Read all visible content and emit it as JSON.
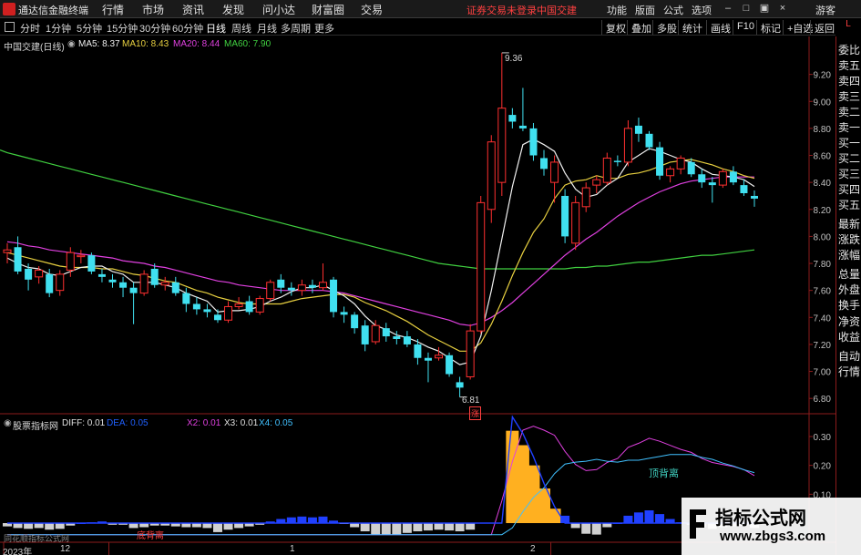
{
  "app": {
    "title": "通达信金融终端",
    "menu": [
      "行情",
      "市场",
      "资讯",
      "发现",
      "问小达",
      "财富圈",
      "交易"
    ],
    "login_status": "证券交易未登录",
    "stock_name": "中国交建",
    "right_menu": [
      "功能",
      "版面",
      "公式",
      "选项"
    ],
    "guest_label": "游客"
  },
  "toolbar": {
    "periods": [
      "分时",
      "1分钟",
      "5分钟",
      "15分钟",
      "30分钟",
      "60分钟",
      "日线",
      "周线",
      "月线",
      "多周期",
      "更多"
    ],
    "active_period": "日线",
    "right_buttons": [
      "复权",
      "叠加",
      "多股",
      "统计",
      "画线",
      "F10",
      "标记",
      "+自选",
      "返回"
    ]
  },
  "side_panel": {
    "top_label": "L",
    "items": [
      "委比",
      "卖五",
      "卖四",
      "卖三",
      "卖二",
      "卖一",
      "买一",
      "买二",
      "买三",
      "买四",
      "买五",
      "最新",
      "涨跌",
      "涨幅",
      "总量",
      "外盘",
      "换手",
      "净资",
      "收益",
      "自动",
      "行情"
    ]
  },
  "main_chart": {
    "title": "中国交建(日线)",
    "ma_legend": [
      {
        "label": "MA5: 8.37",
        "color": "#f0f0f0"
      },
      {
        "label": "MA10: 8.43",
        "color": "#e8d040"
      },
      {
        "label": "MA20: 8.44",
        "color": "#e040e0"
      },
      {
        "label": "MA60: 7.90",
        "color": "#40d040"
      }
    ],
    "price_ticks": [
      "9.20",
      "9.00",
      "8.80",
      "8.60",
      "8.40",
      "8.20",
      "8.00",
      "7.80",
      "7.60",
      "7.40",
      "7.20",
      "7.00",
      "6.80"
    ],
    "high_label": "9.36",
    "low_label": "6.81",
    "rise_marker": "涨"
  },
  "indicator": {
    "title": "股票指标网",
    "legend": [
      {
        "label": "DIFF: 0.01",
        "color": "#e0e0e0"
      },
      {
        "label": "DEA: 0.05",
        "color": "#2060ff"
      },
      {
        "label": "X2: 0.01",
        "color": "#e040e0"
      },
      {
        "label": "X3: 0.01",
        "color": "#e0e0e0"
      },
      {
        "label": "X4: 0.05",
        "color": "#40c0ff"
      }
    ],
    "ticks": [
      "0.30",
      "0.20",
      "0.10"
    ],
    "annotation_top": "顶背离",
    "annotation_bottom": "底背离"
  },
  "bottom_axis": {
    "labels": [
      "2023年",
      "12",
      "1",
      "2"
    ],
    "left_caption": "同花顺指标公式网"
  },
  "watermark": {
    "title": "指标公式网",
    "url": "www.zbgs3.com"
  },
  "colors": {
    "up": "#ff3030",
    "down": "#40e0f0",
    "ma5": "#f0f0f0",
    "ma10": "#e8d040",
    "ma20": "#e040e0",
    "ma60": "#40d040",
    "macd_hist": "#ffb020",
    "macd_blue": "#2040ff"
  },
  "chart_data": {
    "type": "candlestick",
    "title": "中国交建(日线)",
    "y_range": [
      6.7,
      9.4
    ],
    "candles": [
      {
        "o": 7.88,
        "h": 7.95,
        "l": 7.8,
        "c": 7.9
      },
      {
        "o": 7.92,
        "h": 8.0,
        "l": 7.72,
        "c": 7.74
      },
      {
        "o": 7.76,
        "h": 7.8,
        "l": 7.6,
        "c": 7.68
      },
      {
        "o": 7.7,
        "h": 7.78,
        "l": 7.65,
        "c": 7.75
      },
      {
        "o": 7.72,
        "h": 7.76,
        "l": 7.55,
        "c": 7.58
      },
      {
        "o": 7.6,
        "h": 7.75,
        "l": 7.56,
        "c": 7.72
      },
      {
        "o": 7.75,
        "h": 7.92,
        "l": 7.7,
        "c": 7.88
      },
      {
        "o": 7.85,
        "h": 7.9,
        "l": 7.8,
        "c": 7.86
      },
      {
        "o": 7.86,
        "h": 7.88,
        "l": 7.72,
        "c": 7.74
      },
      {
        "o": 7.72,
        "h": 7.76,
        "l": 7.66,
        "c": 7.7
      },
      {
        "o": 7.68,
        "h": 7.72,
        "l": 7.62,
        "c": 7.66
      },
      {
        "o": 7.66,
        "h": 7.7,
        "l": 7.55,
        "c": 7.62
      },
      {
        "o": 7.62,
        "h": 7.66,
        "l": 7.35,
        "c": 7.58
      },
      {
        "o": 7.58,
        "h": 7.75,
        "l": 7.56,
        "c": 7.72
      },
      {
        "o": 7.76,
        "h": 7.8,
        "l": 7.62,
        "c": 7.64
      },
      {
        "o": 7.64,
        "h": 7.7,
        "l": 7.6,
        "c": 7.66
      },
      {
        "o": 7.66,
        "h": 7.7,
        "l": 7.56,
        "c": 7.58
      },
      {
        "o": 7.58,
        "h": 7.62,
        "l": 7.44,
        "c": 7.5
      },
      {
        "o": 7.5,
        "h": 7.55,
        "l": 7.42,
        "c": 7.46
      },
      {
        "o": 7.46,
        "h": 7.5,
        "l": 7.4,
        "c": 7.44
      },
      {
        "o": 7.42,
        "h": 7.46,
        "l": 7.36,
        "c": 7.38
      },
      {
        "o": 7.38,
        "h": 7.52,
        "l": 7.36,
        "c": 7.48
      },
      {
        "o": 7.48,
        "h": 7.55,
        "l": 7.46,
        "c": 7.5
      },
      {
        "o": 7.52,
        "h": 7.56,
        "l": 7.42,
        "c": 7.44
      },
      {
        "o": 7.44,
        "h": 7.56,
        "l": 7.42,
        "c": 7.54
      },
      {
        "o": 7.54,
        "h": 7.68,
        "l": 7.52,
        "c": 7.66
      },
      {
        "o": 7.68,
        "h": 7.72,
        "l": 7.58,
        "c": 7.62
      },
      {
        "o": 7.62,
        "h": 7.66,
        "l": 7.56,
        "c": 7.6
      },
      {
        "o": 7.6,
        "h": 7.68,
        "l": 7.56,
        "c": 7.64
      },
      {
        "o": 7.64,
        "h": 7.68,
        "l": 7.58,
        "c": 7.62
      },
      {
        "o": 7.62,
        "h": 7.8,
        "l": 7.6,
        "c": 7.66
      },
      {
        "o": 7.68,
        "h": 7.7,
        "l": 7.4,
        "c": 7.44
      },
      {
        "o": 7.44,
        "h": 7.48,
        "l": 7.36,
        "c": 7.42
      },
      {
        "o": 7.42,
        "h": 7.44,
        "l": 7.28,
        "c": 7.32
      },
      {
        "o": 7.34,
        "h": 7.38,
        "l": 7.15,
        "c": 7.2
      },
      {
        "o": 7.22,
        "h": 7.38,
        "l": 7.2,
        "c": 7.34
      },
      {
        "o": 7.32,
        "h": 7.36,
        "l": 7.22,
        "c": 7.26
      },
      {
        "o": 7.26,
        "h": 7.3,
        "l": 7.2,
        "c": 7.24
      },
      {
        "o": 7.26,
        "h": 7.3,
        "l": 7.18,
        "c": 7.2
      },
      {
        "o": 7.2,
        "h": 7.24,
        "l": 7.05,
        "c": 7.1
      },
      {
        "o": 7.1,
        "h": 7.14,
        "l": 6.92,
        "c": 7.08
      },
      {
        "o": 7.1,
        "h": 7.18,
        "l": 7.08,
        "c": 7.12
      },
      {
        "o": 7.12,
        "h": 7.14,
        "l": 6.96,
        "c": 6.98
      },
      {
        "o": 6.92,
        "h": 6.96,
        "l": 6.81,
        "c": 6.88
      },
      {
        "o": 6.96,
        "h": 7.35,
        "l": 6.94,
        "c": 7.3
      },
      {
        "o": 7.3,
        "h": 8.3,
        "l": 7.28,
        "c": 8.25
      },
      {
        "o": 8.2,
        "h": 8.75,
        "l": 8.1,
        "c": 8.7
      },
      {
        "o": 8.4,
        "h": 9.36,
        "l": 8.3,
        "c": 8.95
      },
      {
        "o": 8.9,
        "h": 8.95,
        "l": 8.8,
        "c": 8.85
      },
      {
        "o": 8.82,
        "h": 9.1,
        "l": 8.78,
        "c": 8.8
      },
      {
        "o": 8.8,
        "h": 8.84,
        "l": 8.56,
        "c": 8.6
      },
      {
        "o": 8.58,
        "h": 8.64,
        "l": 8.45,
        "c": 8.5
      },
      {
        "o": 8.4,
        "h": 8.6,
        "l": 8.25,
        "c": 8.55
      },
      {
        "o": 8.3,
        "h": 8.35,
        "l": 7.95,
        "c": 8.0
      },
      {
        "o": 7.95,
        "h": 8.3,
        "l": 7.9,
        "c": 8.25
      },
      {
        "o": 8.22,
        "h": 8.4,
        "l": 8.18,
        "c": 8.36
      },
      {
        "o": 8.38,
        "h": 8.45,
        "l": 8.32,
        "c": 8.42
      },
      {
        "o": 8.4,
        "h": 8.62,
        "l": 8.38,
        "c": 8.58
      },
      {
        "o": 8.56,
        "h": 8.6,
        "l": 8.52,
        "c": 8.55
      },
      {
        "o": 8.55,
        "h": 8.86,
        "l": 8.52,
        "c": 8.8
      },
      {
        "o": 8.82,
        "h": 8.88,
        "l": 8.7,
        "c": 8.76
      },
      {
        "o": 8.76,
        "h": 8.78,
        "l": 8.64,
        "c": 8.66
      },
      {
        "o": 8.66,
        "h": 8.7,
        "l": 8.42,
        "c": 8.45
      },
      {
        "o": 8.45,
        "h": 8.52,
        "l": 8.4,
        "c": 8.5
      },
      {
        "o": 8.5,
        "h": 8.6,
        "l": 8.46,
        "c": 8.58
      },
      {
        "o": 8.55,
        "h": 8.58,
        "l": 8.44,
        "c": 8.46
      },
      {
        "o": 8.46,
        "h": 8.5,
        "l": 8.36,
        "c": 8.4
      },
      {
        "o": 8.4,
        "h": 8.44,
        "l": 8.25,
        "c": 8.38
      },
      {
        "o": 8.38,
        "h": 8.5,
        "l": 8.36,
        "c": 8.48
      },
      {
        "o": 8.48,
        "h": 8.52,
        "l": 8.38,
        "c": 8.4
      },
      {
        "o": 8.38,
        "h": 8.42,
        "l": 8.3,
        "c": 8.32
      },
      {
        "o": 8.3,
        "h": 8.34,
        "l": 8.22,
        "c": 8.28
      }
    ],
    "ma5": [
      7.84,
      7.8,
      7.77,
      7.76,
      7.72,
      7.71,
      7.74,
      7.77,
      7.78,
      7.78,
      7.74,
      7.72,
      7.66,
      7.66,
      7.66,
      7.64,
      7.62,
      7.58,
      7.55,
      7.52,
      7.44,
      7.45,
      7.45,
      7.46,
      7.48,
      7.52,
      7.55,
      7.59,
      7.62,
      7.62,
      7.64,
      7.6,
      7.56,
      7.5,
      7.41,
      7.34,
      7.31,
      7.27,
      7.25,
      7.22,
      7.18,
      7.15,
      7.1,
      7.05,
      7.07,
      7.26,
      7.6,
      7.98,
      8.37,
      8.68,
      8.72,
      8.68,
      8.63,
      8.47,
      8.35,
      8.29,
      8.31,
      8.38,
      8.43,
      8.55,
      8.6,
      8.65,
      8.63,
      8.6,
      8.57,
      8.55,
      8.5,
      8.46,
      8.45,
      8.44,
      8.42,
      8.37
    ],
    "ma10": [
      7.88,
      7.86,
      7.84,
      7.82,
      7.8,
      7.78,
      7.77,
      7.77,
      7.77,
      7.76,
      7.76,
      7.74,
      7.72,
      7.71,
      7.69,
      7.67,
      7.66,
      7.63,
      7.6,
      7.58,
      7.55,
      7.53,
      7.51,
      7.5,
      7.5,
      7.5,
      7.5,
      7.52,
      7.54,
      7.55,
      7.56,
      7.57,
      7.57,
      7.55,
      7.51,
      7.48,
      7.45,
      7.41,
      7.37,
      7.32,
      7.27,
      7.23,
      7.19,
      7.15,
      7.15,
      7.21,
      7.35,
      7.52,
      7.71,
      7.88,
      8.03,
      8.13,
      8.28,
      8.38,
      8.41,
      8.42,
      8.45,
      8.43,
      8.43,
      8.46,
      8.47,
      8.49,
      8.52,
      8.55,
      8.56,
      8.57,
      8.55,
      8.53,
      8.5,
      8.48,
      8.45,
      8.43
    ],
    "ma20": [
      7.96,
      7.95,
      7.93,
      7.92,
      7.9,
      7.89,
      7.88,
      7.87,
      7.86,
      7.85,
      7.84,
      7.82,
      7.81,
      7.8,
      7.78,
      7.77,
      7.75,
      7.73,
      7.71,
      7.69,
      7.67,
      7.66,
      7.64,
      7.63,
      7.62,
      7.61,
      7.6,
      7.6,
      7.6,
      7.6,
      7.6,
      7.59,
      7.58,
      7.56,
      7.54,
      7.52,
      7.5,
      7.48,
      7.46,
      7.44,
      7.42,
      7.4,
      7.38,
      7.35,
      7.34,
      7.36,
      7.4,
      7.45,
      7.51,
      7.58,
      7.65,
      7.72,
      7.79,
      7.86,
      7.92,
      7.98,
      8.03,
      8.09,
      8.15,
      8.2,
      8.25,
      8.29,
      8.33,
      8.36,
      8.39,
      8.41,
      8.42,
      8.43,
      8.44,
      8.44,
      8.44,
      8.44
    ],
    "ma60": [
      8.62,
      8.6,
      8.58,
      8.56,
      8.54,
      8.52,
      8.5,
      8.48,
      8.46,
      8.44,
      8.42,
      8.4,
      8.38,
      8.36,
      8.34,
      8.32,
      8.3,
      8.28,
      8.26,
      8.24,
      8.22,
      8.2,
      8.18,
      8.16,
      8.14,
      8.12,
      8.1,
      8.08,
      8.06,
      8.04,
      8.02,
      8.0,
      7.98,
      7.96,
      7.94,
      7.92,
      7.9,
      7.88,
      7.86,
      7.84,
      7.82,
      7.8,
      7.79,
      7.78,
      7.77,
      7.76,
      7.76,
      7.76,
      7.76,
      7.76,
      7.76,
      7.76,
      7.76,
      7.76,
      7.77,
      7.77,
      7.78,
      7.78,
      7.79,
      7.8,
      7.81,
      7.81,
      7.82,
      7.83,
      7.84,
      7.85,
      7.86,
      7.86,
      7.87,
      7.88,
      7.89,
      7.9
    ],
    "indicator_hist": [
      0.0,
      0.0,
      0.0,
      0.0,
      0.0,
      0.0,
      0.0,
      0.0,
      0.0,
      0.0,
      0.0,
      0.0,
      0.0,
      0.0,
      0.0,
      0.0,
      0.0,
      0.0,
      0.0,
      0.0,
      0.0,
      0.0,
      0.0,
      0.0,
      0.0,
      0.0,
      0.0,
      0.0,
      0.0,
      0.0,
      0.0,
      0.0,
      0.0,
      0.0,
      0.0,
      0.0,
      0.0,
      0.0,
      0.0,
      0.0,
      0.0,
      0.0,
      0.0,
      0.0,
      0.0,
      0.0,
      0.0,
      0.0,
      0.32,
      0.27,
      0.2,
      0.12,
      0.05,
      0.0,
      0.0,
      0.0,
      0.0,
      0.0,
      0.0,
      0.0,
      0.0,
      0.0,
      0.0,
      0.0,
      0.0,
      0.0,
      0.0,
      0.0,
      0.0,
      0.0,
      0.0,
      0.0
    ],
    "indicator_ticks": [
      0.3,
      0.2,
      0.1
    ]
  }
}
